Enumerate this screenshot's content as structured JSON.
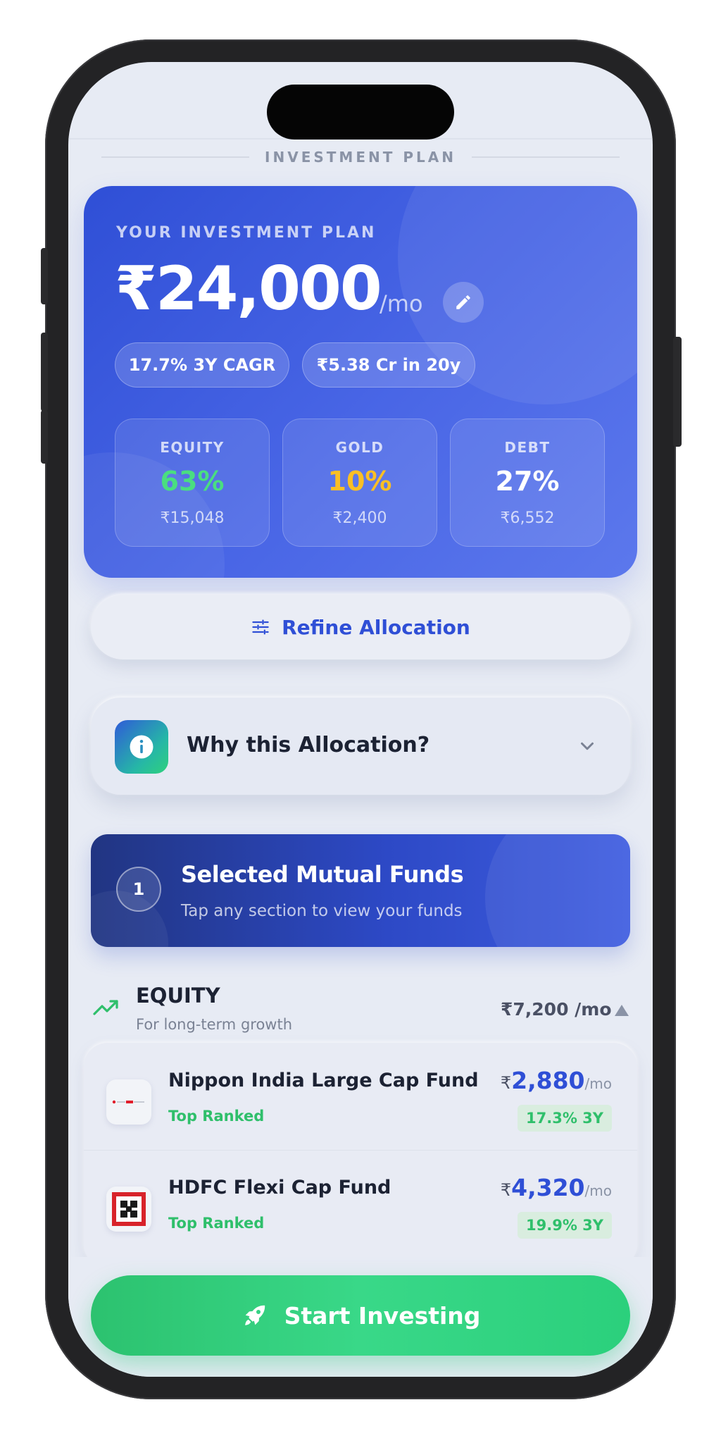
{
  "page": {
    "title": "INVESTMENT PLAN"
  },
  "plan": {
    "label": "YOUR INVESTMENT PLAN",
    "amount": "₹24,000",
    "unit": "/mo",
    "pills": [
      "17.7% 3Y CAGR",
      "₹5.38 Cr in 20y"
    ],
    "allocations": [
      {
        "name": "EQUITY",
        "percent": "63%",
        "amount": "₹15,048",
        "color": "#4ade80"
      },
      {
        "name": "GOLD",
        "percent": "10%",
        "amount": "₹2,400",
        "color": "#fbbf24"
      },
      {
        "name": "DEBT",
        "percent": "27%",
        "amount": "₹6,552",
        "color": "#ffffff"
      }
    ]
  },
  "refine": {
    "label": "Refine Allocation"
  },
  "why": {
    "label": "Why this Allocation?"
  },
  "funds_banner": {
    "step": "1",
    "title": "Selected Mutual Funds",
    "subtitle": "Tap any section to view your funds"
  },
  "equity_section": {
    "title": "EQUITY",
    "subtitle": "For long-term growth",
    "amount": "₹7,200 /mo",
    "funds": [
      {
        "name": "Nippon India Large Cap Fund",
        "tag": "Top Ranked",
        "currency": "₹",
        "amount": "2,880",
        "per": "/mo",
        "return": "17.3% 3Y"
      },
      {
        "name": "HDFC Flexi Cap Fund",
        "tag": "Top Ranked",
        "currency": "₹",
        "amount": "4,320",
        "per": "/mo",
        "return": "19.9% 3Y"
      }
    ]
  },
  "cta": {
    "label": "Start Investing"
  },
  "colors": {
    "accent_blue": "#2f4fd6",
    "accent_green": "#2fbf6b"
  }
}
